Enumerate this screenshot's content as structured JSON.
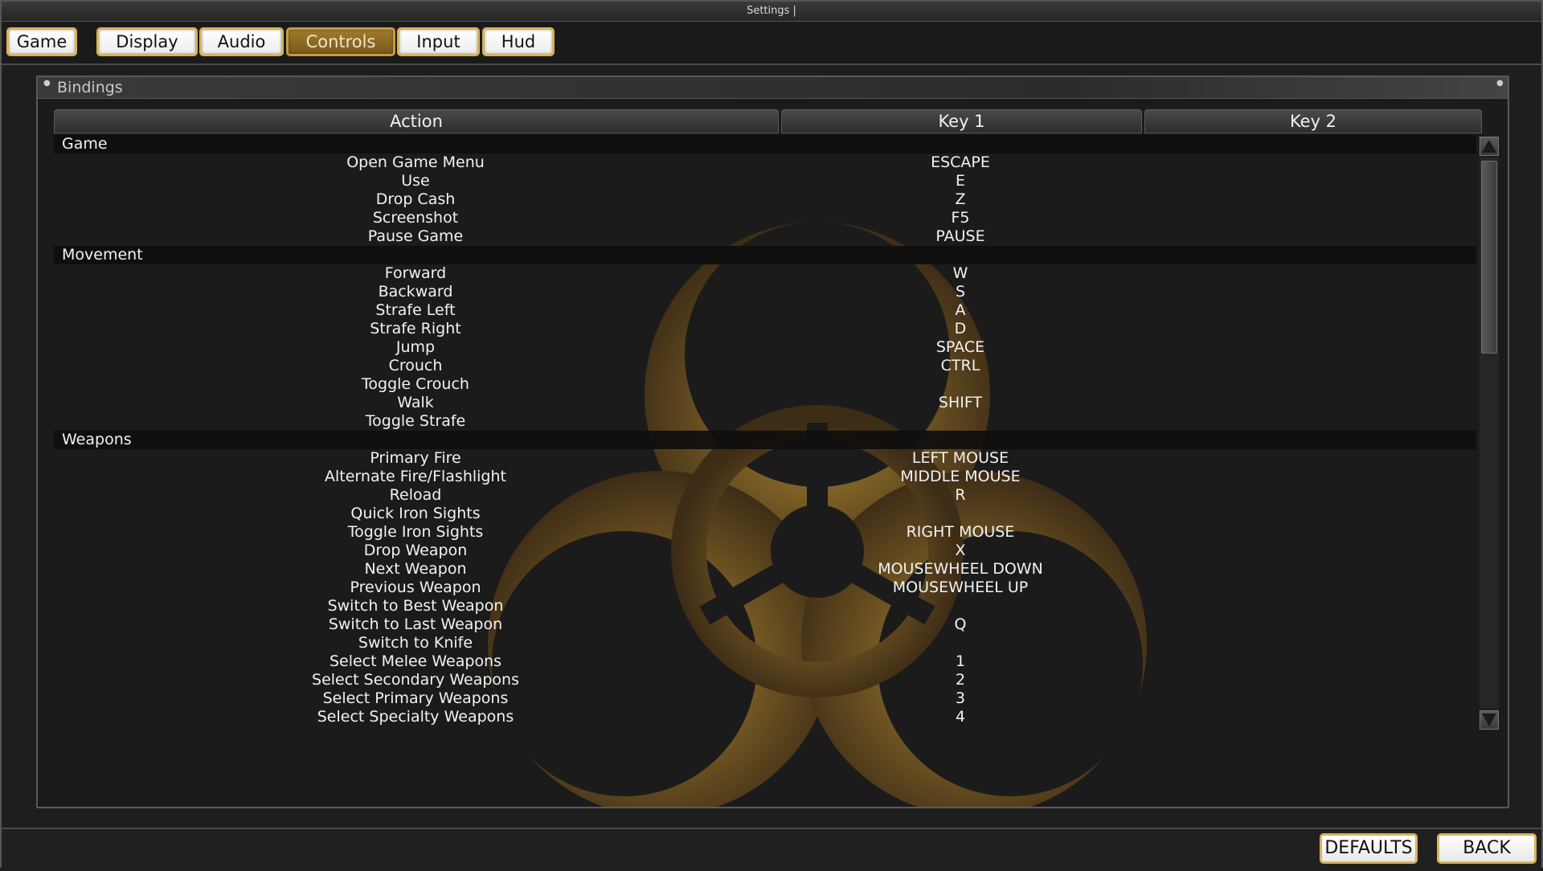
{
  "window": {
    "title": "Settings |"
  },
  "tabs": [
    {
      "label": "Game",
      "active": false
    },
    {
      "label": "Display",
      "active": false
    },
    {
      "label": "Audio",
      "active": false
    },
    {
      "label": "Controls",
      "active": true
    },
    {
      "label": "Input",
      "active": false
    },
    {
      "label": "Hud",
      "active": false
    }
  ],
  "panel": {
    "title": "Bindings"
  },
  "columns": {
    "action": "Action",
    "key1": "Key 1",
    "key2": "Key 2"
  },
  "groups": [
    {
      "name": "Game",
      "rows": [
        {
          "action": "Open Game Menu",
          "key1": "ESCAPE",
          "key2": ""
        },
        {
          "action": "Use",
          "key1": "E",
          "key2": ""
        },
        {
          "action": "Drop Cash",
          "key1": "Z",
          "key2": ""
        },
        {
          "action": "Screenshot",
          "key1": "F5",
          "key2": ""
        },
        {
          "action": "Pause Game",
          "key1": "PAUSE",
          "key2": ""
        }
      ]
    },
    {
      "name": "Movement",
      "rows": [
        {
          "action": "Forward",
          "key1": "W",
          "key2": ""
        },
        {
          "action": "Backward",
          "key1": "S",
          "key2": ""
        },
        {
          "action": "Strafe Left",
          "key1": "A",
          "key2": ""
        },
        {
          "action": "Strafe Right",
          "key1": "D",
          "key2": ""
        },
        {
          "action": "Jump",
          "key1": "SPACE",
          "key2": ""
        },
        {
          "action": "Crouch",
          "key1": "CTRL",
          "key2": ""
        },
        {
          "action": "Toggle Crouch",
          "key1": "",
          "key2": ""
        },
        {
          "action": "Walk",
          "key1": "SHIFT",
          "key2": ""
        },
        {
          "action": "Toggle Strafe",
          "key1": "",
          "key2": ""
        }
      ]
    },
    {
      "name": "Weapons",
      "rows": [
        {
          "action": "Primary Fire",
          "key1": "LEFT MOUSE",
          "key2": ""
        },
        {
          "action": "Alternate Fire/Flashlight",
          "key1": "MIDDLE MOUSE",
          "key2": ""
        },
        {
          "action": "Reload",
          "key1": "R",
          "key2": ""
        },
        {
          "action": "Quick Iron Sights",
          "key1": "",
          "key2": ""
        },
        {
          "action": "Toggle Iron Sights",
          "key1": "RIGHT MOUSE",
          "key2": ""
        },
        {
          "action": "Drop Weapon",
          "key1": "X",
          "key2": ""
        },
        {
          "action": "Next Weapon",
          "key1": "MOUSEWHEEL DOWN",
          "key2": ""
        },
        {
          "action": "Previous Weapon",
          "key1": "MOUSEWHEEL UP",
          "key2": ""
        },
        {
          "action": "Switch to Best Weapon",
          "key1": "",
          "key2": ""
        },
        {
          "action": "Switch to Last Weapon",
          "key1": "Q",
          "key2": ""
        },
        {
          "action": "Switch to Knife",
          "key1": "",
          "key2": ""
        },
        {
          "action": "Select Melee Weapons",
          "key1": "1",
          "key2": ""
        },
        {
          "action": "Select Secondary Weapons",
          "key1": "2",
          "key2": ""
        },
        {
          "action": "Select Primary Weapons",
          "key1": "3",
          "key2": ""
        },
        {
          "action": "Select Specialty Weapons",
          "key1": "4",
          "key2": ""
        }
      ]
    }
  ],
  "buttons": {
    "defaults": "DEFAULTS",
    "back": "BACK"
  },
  "colors": {
    "accent": "#d8b257",
    "active_tab": "#8a6624",
    "background": "#1e1e1e"
  },
  "icons": {
    "scroll_up": "triangle-up",
    "scroll_down": "triangle-down",
    "background": "biohazard-symbol"
  }
}
